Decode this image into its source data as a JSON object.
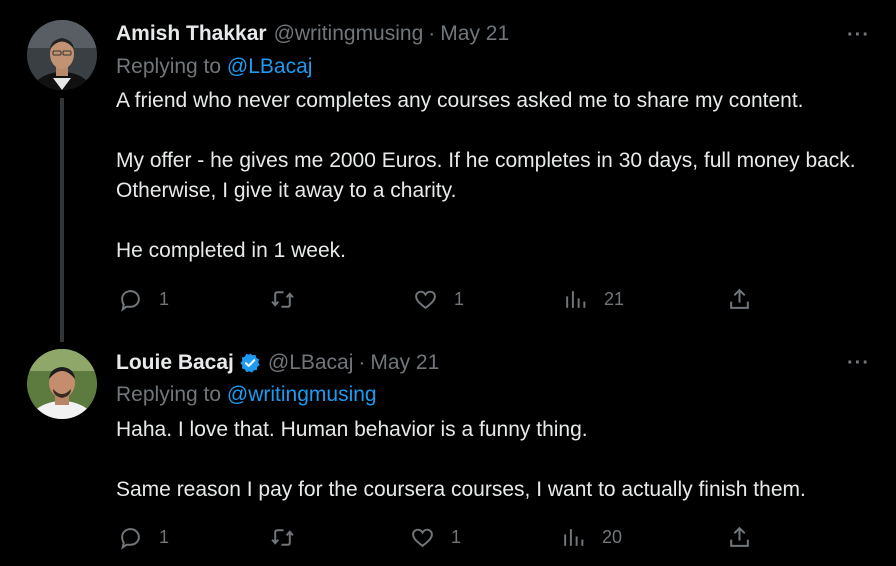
{
  "tweets": [
    {
      "name": "Amish Thakkar",
      "verified": false,
      "handle": "@writingmusing",
      "separator": "·",
      "date": "May 21",
      "more": "···",
      "replying_prefix": "Replying to",
      "replying_to": "@LBacaj",
      "paragraphs": [
        "A friend who never completes any courses asked me to share my content.",
        "My offer - he gives me 2000 Euros. If he completes in 30 days, full money back. Otherwise, I give it away to a charity.",
        "He completed in 1 week."
      ],
      "replies": "1",
      "retweets": "",
      "likes": "1",
      "views": "21"
    },
    {
      "name": "Louie Bacaj",
      "verified": true,
      "handle": "@LBacaj",
      "separator": "·",
      "date": "May 21",
      "more": "···",
      "replying_prefix": "Replying to",
      "replying_to": "@writingmusing",
      "paragraphs": [
        "Haha. I love that. Human behavior is a funny thing.",
        "Same reason I pay for the coursera courses, I want to actually finish them."
      ],
      "replies": "1",
      "retweets": "",
      "likes": "1",
      "views": "20"
    }
  ],
  "colors": {
    "background": "#000000",
    "text": "#e7e9ea",
    "secondary": "#71767b",
    "link": "#1d9bf0",
    "thread_line": "#333639"
  },
  "icons": [
    "reply-icon",
    "retweet-icon",
    "like-icon",
    "views-icon",
    "share-icon",
    "verified-badge-icon",
    "more-icon"
  ]
}
